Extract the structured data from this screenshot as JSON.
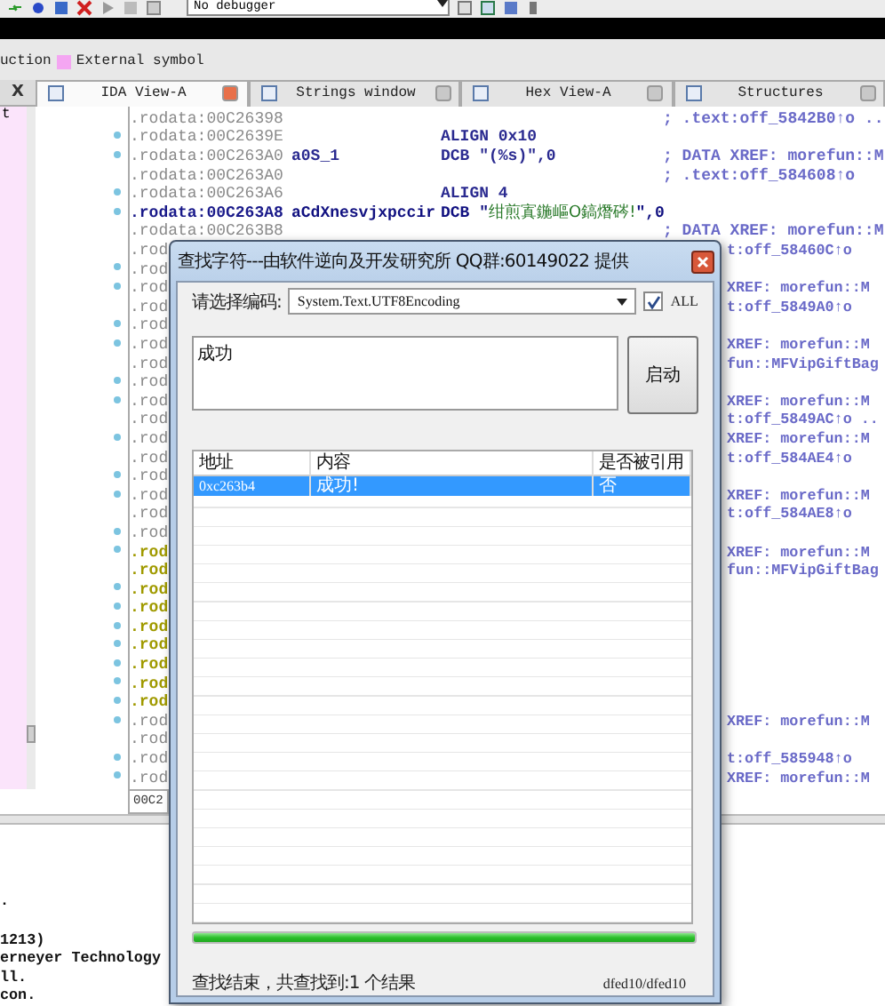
{
  "toolbar": {
    "debugger": "No debugger"
  },
  "legend": {
    "cut_label": "uction",
    "items": [
      {
        "label": "External symbol",
        "color": "#f4a6f2"
      }
    ]
  },
  "side_panel": {
    "label": "t",
    "close": "X"
  },
  "tabs": [
    {
      "label": "IDA View-A",
      "selected": true
    },
    {
      "label": "Strings window",
      "selected": false
    },
    {
      "label": "Hex View-A",
      "selected": false
    },
    {
      "label": "Structures",
      "selected": false
    }
  ],
  "code_lines": [
    {
      "address": ".rodata:00C26398",
      "comment": "; .text:off_5842B0↑o ..",
      "marked": false,
      "kind": "normal"
    },
    {
      "address": ".rodata:00C2639E",
      "instruction": "ALIGN 0x10",
      "marked": true,
      "kind": "normal"
    },
    {
      "address": ".rodata:00C263A0",
      "label": "a0S_1",
      "instruction": "DCB \"(%s)\",0",
      "comment": "; DATA XREF: morefun::M",
      "marked": true,
      "kind": "normal"
    },
    {
      "address": ".rodata:00C263A0",
      "comment": "; .text:off_584608↑o",
      "marked": false,
      "kind": "normal"
    },
    {
      "address": ".rodata:00C263A6",
      "instruction": "ALIGN 4",
      "marked": true,
      "kind": "normal"
    },
    {
      "address": ".rodata:00C263A8",
      "label": "aCdXnesvjxpccir",
      "instruction": "DCB \"绀煎寘鍦嶇О鎬熸硶!\",0",
      "marked": true,
      "kind": "bold"
    },
    {
      "address": ".rodata:00C263B8",
      "comment": "; DATA XREF: morefun::M",
      "marked": false,
      "kind": "normal"
    },
    {
      "address": ".rod",
      "tail": "t:off_58460C↑o",
      "marked": false,
      "kind": "normal"
    },
    {
      "address": ".rod",
      "marked": true,
      "kind": "normal"
    },
    {
      "address": ".rod",
      "tail": "XREF: morefun::M",
      "marked": true,
      "kind": "normal"
    },
    {
      "address": ".rod",
      "tail": "t:off_5849A0↑o",
      "marked": false,
      "kind": "normal"
    },
    {
      "address": ".rod",
      "marked": true,
      "kind": "normal"
    },
    {
      "address": ".rod",
      "tail": "XREF: morefun::M",
      "marked": true,
      "kind": "normal"
    },
    {
      "address": ".rod",
      "tail": "fun::MFVipGiftBag",
      "marked": false,
      "kind": "normal"
    },
    {
      "address": ".rod",
      "marked": true,
      "kind": "normal"
    },
    {
      "address": ".rod",
      "tail": "XREF: morefun::M",
      "marked": true,
      "kind": "normal"
    },
    {
      "address": ".rod",
      "tail": "t:off_5849AC↑o ..",
      "marked": false,
      "kind": "normal"
    },
    {
      "address": ".rod",
      "tail": "XREF: morefun::M",
      "marked": true,
      "kind": "normal"
    },
    {
      "address": ".rod",
      "tail": "t:off_584AE4↑o",
      "marked": false,
      "kind": "normal"
    },
    {
      "address": ".rod",
      "marked": true,
      "kind": "normal"
    },
    {
      "address": ".rod",
      "tail": "XREF: morefun::M",
      "marked": true,
      "kind": "normal"
    },
    {
      "address": ".rod",
      "tail": "t:off_584AE8↑o",
      "marked": false,
      "kind": "normal"
    },
    {
      "address": ".rod",
      "marked": true,
      "kind": "normal"
    },
    {
      "address": ".rod",
      "tail": "XREF: morefun::M",
      "marked": true,
      "kind": "olive"
    },
    {
      "address": ".rod",
      "tail": "fun::MFVipGiftBag",
      "marked": false,
      "kind": "olive"
    },
    {
      "address": ".rod",
      "marked": true,
      "kind": "olive"
    },
    {
      "address": ".rod",
      "marked": true,
      "kind": "olive"
    },
    {
      "address": ".rod",
      "marked": true,
      "kind": "olive"
    },
    {
      "address": ".rod",
      "marked": true,
      "kind": "olive"
    },
    {
      "address": ".rod",
      "marked": true,
      "kind": "olive"
    },
    {
      "address": ".rod",
      "marked": true,
      "kind": "olive"
    },
    {
      "address": ".rod",
      "marked": true,
      "kind": "olive"
    },
    {
      "address": ".rod",
      "tail": "XREF: morefun::M",
      "marked": true,
      "kind": "normal"
    },
    {
      "address": ".rod",
      "marked": false,
      "kind": "normal"
    },
    {
      "address": ".rod",
      "tail": "t:off_585948↑o",
      "marked": true,
      "kind": "normal"
    },
    {
      "address": ".rod",
      "tail": "XREF: morefun::M",
      "marked": true,
      "kind": "normal"
    }
  ],
  "status": "00C2",
  "output_blocks": [
    [
      "."
    ],
    [
      "1213)",
      "erneyer Technology",
      "ll.",
      "con."
    ]
  ],
  "dialog": {
    "title": "查找字符---由软件逆向及开发研究所 QQ群:60149022 提供",
    "encoding_label": "请选择编码:",
    "encoding": "System.Text.UTF8Encoding",
    "all_checkbox": {
      "label": "ALL",
      "checked": true
    },
    "search_text": "成功",
    "start_button": "启动",
    "columns": [
      "地址",
      "内容",
      "是否被引用"
    ],
    "rows": [
      {
        "address": "0xc263b4",
        "content": "成功!",
        "referenced": "否",
        "selected": true
      }
    ],
    "progress": {
      "level": 1
    },
    "status": "查找结束，共查找到:1 个结果",
    "counter": "dfed10/dfed10"
  }
}
